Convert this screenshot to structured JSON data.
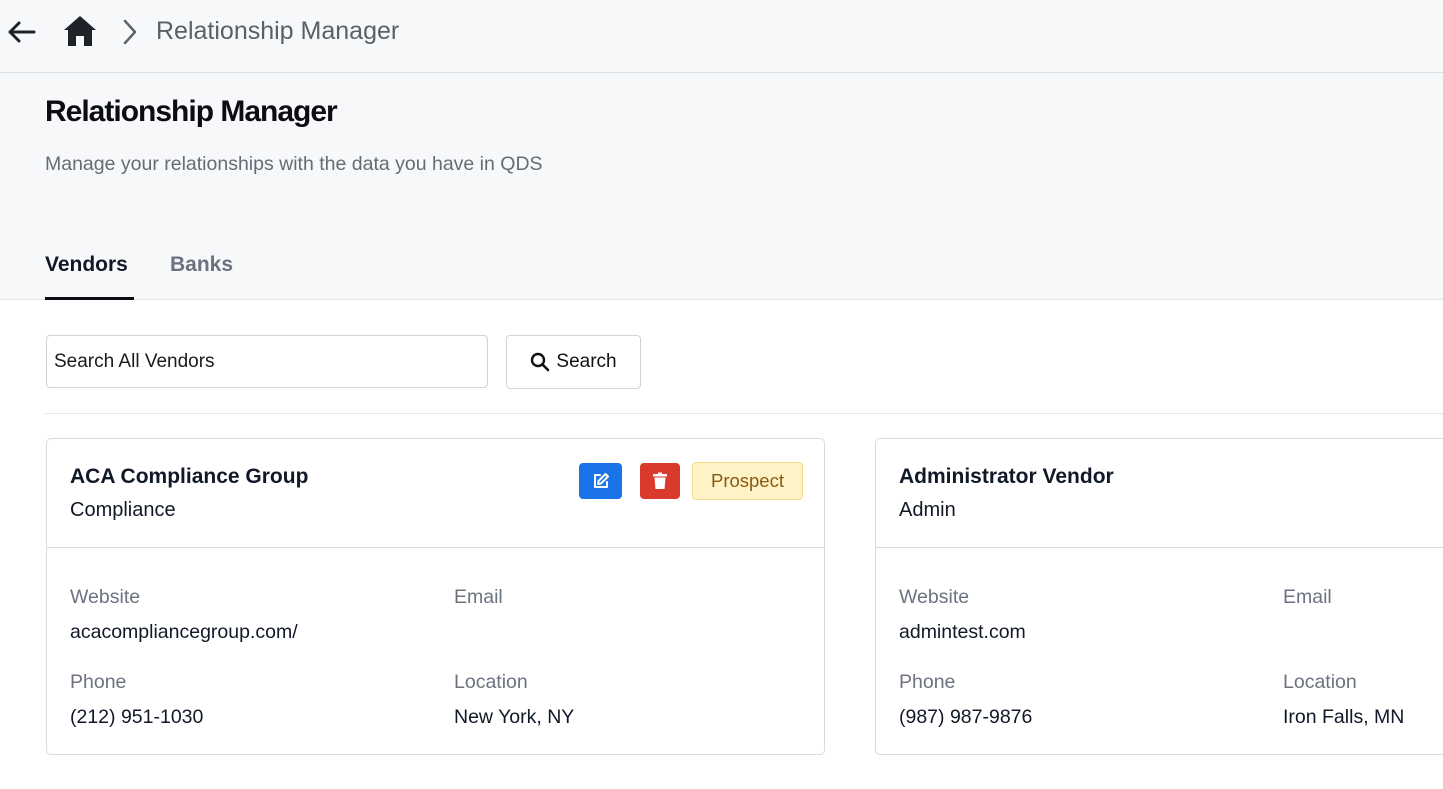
{
  "breadcrumb": {
    "current": "Relationship Manager"
  },
  "page": {
    "title": "Relationship Manager",
    "subtitle": "Manage your relationships with the data you have in QDS"
  },
  "tabs": [
    {
      "label": "Vendors",
      "active": true
    },
    {
      "label": "Banks",
      "active": false
    }
  ],
  "search": {
    "placeholder": "Search All Vendors",
    "value": "",
    "button_label": "Search"
  },
  "labels": {
    "website": "Website",
    "email": "Email",
    "phone": "Phone",
    "location": "Location"
  },
  "vendors": [
    {
      "name": "ACA Compliance Group",
      "category": "Compliance",
      "status": "Prospect",
      "website": "acacompliancegroup.com/",
      "email": "",
      "phone": "(212) 951-1030",
      "location": "New York, NY"
    },
    {
      "name": "Administrator Vendor",
      "category": "Admin",
      "website": "admintest.com",
      "email": "",
      "phone": "(987) 987-9876",
      "location": "Iron Falls, MN"
    }
  ],
  "colors": {
    "edit_button": "#1a73e8",
    "delete_button": "#d93a2b",
    "prospect_badge_bg": "#fdf3c7",
    "prospect_badge_text": "#8a5a13",
    "header_bg": "#f7f8fa"
  },
  "icons": {
    "back": "arrow-left-icon",
    "home": "home-icon",
    "separator": "chevron-right-icon",
    "search": "magnifier-icon",
    "edit": "pencil-square-icon",
    "delete": "trash-icon"
  }
}
